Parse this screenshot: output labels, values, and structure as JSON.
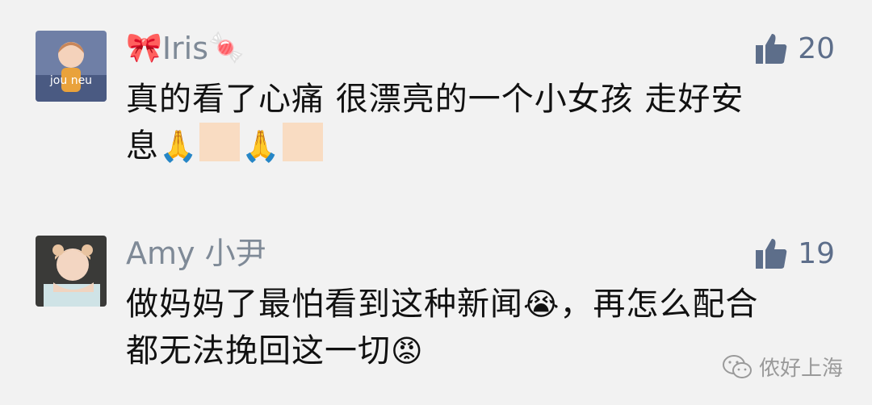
{
  "comments": [
    {
      "name_prefix_emoji": "🎀",
      "name": "Iris",
      "name_suffix_emoji": "🍬",
      "likes": "20",
      "text_line1": "真的看了心痛 很漂亮的一个小女孩 走好安",
      "text_line2": "息",
      "text_emojis": [
        "🙏",
        "🙏"
      ]
    },
    {
      "name": "Amy 小尹",
      "likes": "19",
      "text_part1": "做妈妈了最怕看到这种新闻",
      "emoji_cry": "😭",
      "text_part2": "，再怎么配合",
      "text_line2": "都无法挽回这一切",
      "emoji_angry": "😡"
    }
  ],
  "watermark": {
    "text": "侬好上海"
  },
  "icons": {
    "like": "thumbs-up-icon",
    "watermark": "wechat-icon"
  },
  "colors": {
    "name": "#7f8a97",
    "like": "#5d6e8a",
    "text": "#111111",
    "background": "#f2f2f2"
  }
}
